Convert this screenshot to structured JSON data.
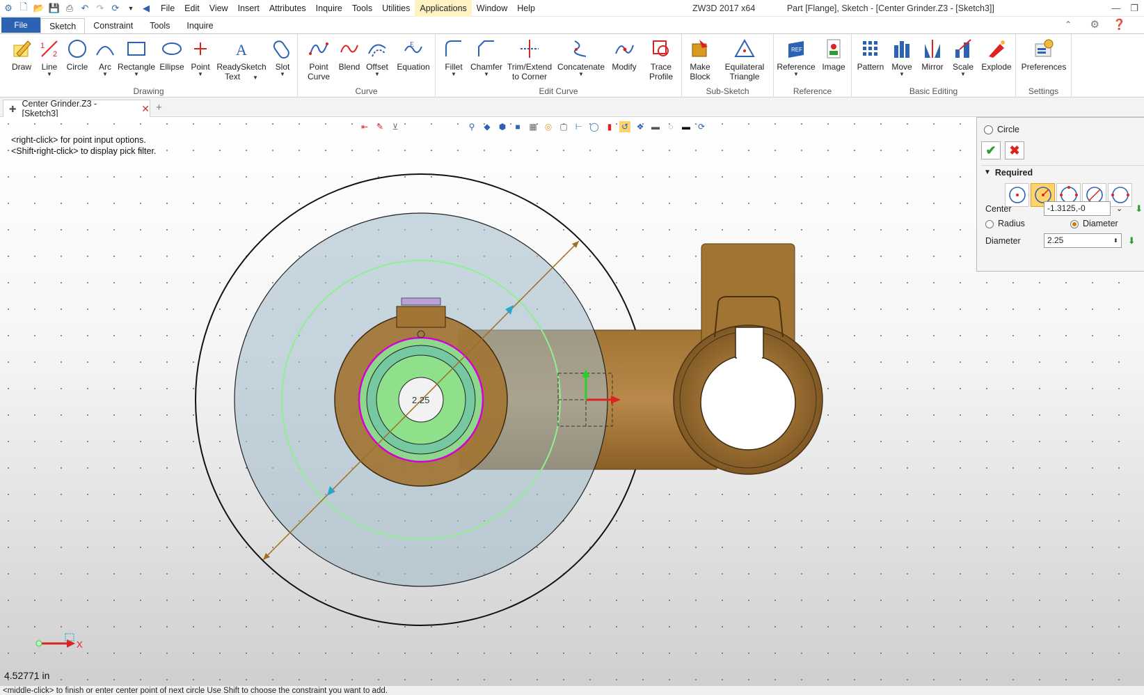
{
  "titlebar": {
    "menu": [
      "File",
      "Edit",
      "View",
      "Insert",
      "Attributes",
      "Inquire",
      "Tools",
      "Utilities",
      "Applications",
      "Window",
      "Help"
    ],
    "app_name": "ZW3D 2017  x64",
    "doc_title": "Part [Flange], Sketch - [Center Grinder.Z3 - [Sketch3]]"
  },
  "ribbon_tabs": {
    "file": "File",
    "tabs": [
      "Sketch",
      "Constraint",
      "Tools",
      "Inquire"
    ]
  },
  "ribbon": {
    "drawing": {
      "label": "Drawing",
      "draw": "Draw",
      "line": "Line",
      "circle": "Circle",
      "arc": "Arc",
      "rectangle": "Rectangle",
      "ellipse": "Ellipse",
      "point": "Point",
      "readysketch_1": "ReadySketch",
      "readysketch_2": "Text",
      "slot": "Slot"
    },
    "curve": {
      "label": "Curve",
      "pointcurve_1": "Point",
      "pointcurve_2": "Curve",
      "blend": "Blend",
      "offset": "Offset",
      "equation": "Equation"
    },
    "editcurve": {
      "label": "Edit Curve",
      "fillet": "Fillet",
      "chamfer": "Chamfer",
      "trim_1": "Trim/Extend",
      "trim_2": "to Corner",
      "concatenate": "Concatenate",
      "modify": "Modify",
      "trace_1": "Trace",
      "trace_2": "Profile"
    },
    "subsketch": {
      "label": "Sub-Sketch",
      "make_1": "Make",
      "make_2": "Block",
      "equi_1": "Equilateral",
      "equi_2": "Triangle"
    },
    "reference": {
      "label": "Reference",
      "reference": "Reference",
      "image": "Image"
    },
    "basicediting": {
      "label": "Basic Editing",
      "pattern": "Pattern",
      "move": "Move",
      "mirror": "Mirror",
      "scale": "Scale",
      "explode": "Explode"
    },
    "settings": {
      "label": "Settings",
      "preferences": "Preferences"
    }
  },
  "doc_tab": {
    "label": "Center Grinder.Z3 - [Sketch3]"
  },
  "viewport": {
    "hint_1": "<right-click> for point input options.",
    "hint_2": "<Shift-right-click> to display pick filter.",
    "dimension_label": "2.25",
    "axis_label": "X",
    "cursor_coord": "4.52771 in"
  },
  "panel": {
    "title": "Circle",
    "section": "Required",
    "center_label": "Center",
    "center_value": "-1.3125,-0",
    "radius_label": "Radius",
    "diameter_option_label": "Diameter",
    "diameter_label": "Diameter",
    "diameter_value": "2.25",
    "selected_mode_index": 1
  },
  "statusbar": {
    "text": "<middle-click> to finish or enter center point of next circle Use Shift to choose the constraint you want to add."
  },
  "colors": {
    "file_tab": "#2b62b3",
    "bronze": "#a8773a",
    "green_circle": "#8ef08e",
    "magenta": "#d400d4",
    "mode_selected": "#ffd36a"
  }
}
